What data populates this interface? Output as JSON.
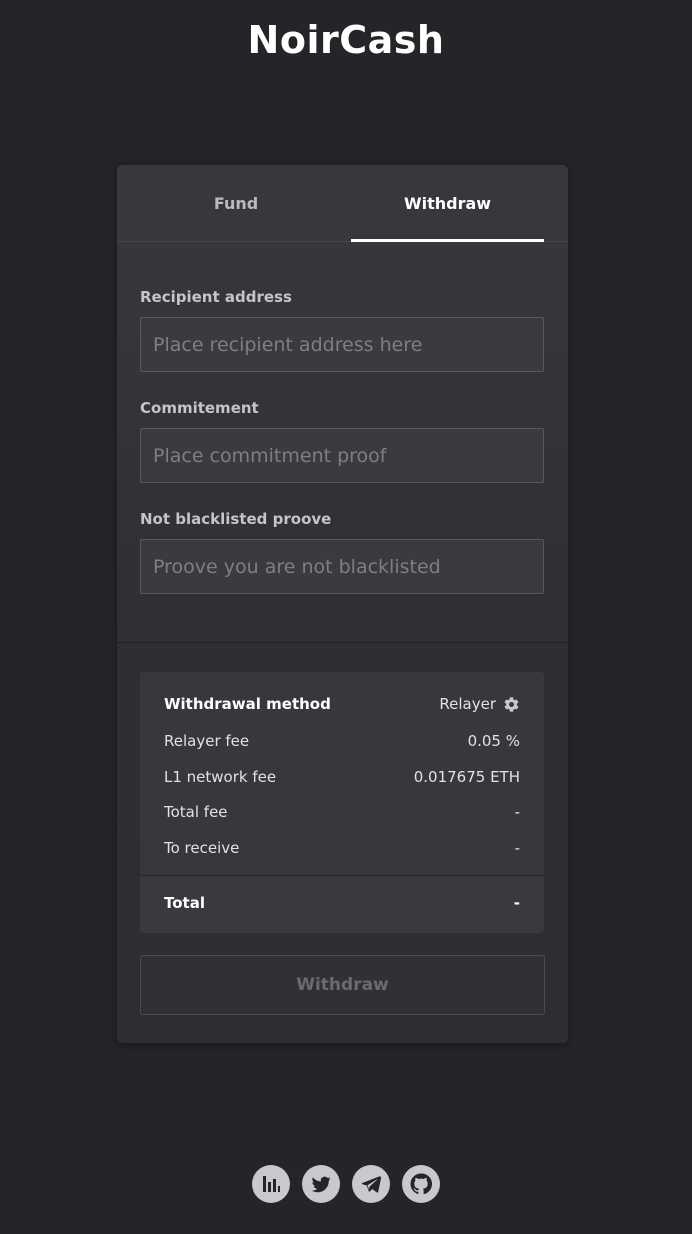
{
  "brand": {
    "title": "NoirCash"
  },
  "tabs": [
    {
      "label": "Fund",
      "active": false
    },
    {
      "label": "Withdraw",
      "active": true
    }
  ],
  "form": {
    "recipient": {
      "label": "Recipient address",
      "placeholder": "Place recipient address here",
      "value": ""
    },
    "commitment": {
      "label": "Commitement",
      "placeholder": "Place commitment proof",
      "value": ""
    },
    "blacklist": {
      "label": "Not blacklisted proove",
      "placeholder": "Proove you are not blacklisted",
      "value": ""
    }
  },
  "summary": {
    "method": {
      "label": "Withdrawal method",
      "value": "Relayer",
      "icon": "gear-icon"
    },
    "rows": [
      {
        "label": "Relayer fee",
        "value": "0.05 %"
      },
      {
        "label": "L1 network fee",
        "value": "0.017675 ETH"
      },
      {
        "label": "Total fee",
        "value": "-"
      },
      {
        "label": "To receive",
        "value": "-"
      }
    ],
    "total": {
      "label": "Total",
      "value": "-"
    }
  },
  "actions": {
    "withdraw_label": "Withdraw",
    "withdraw_enabled": false
  },
  "footer": {
    "icons": [
      "stats-icon",
      "twitter-icon",
      "telegram-icon",
      "github-icon"
    ]
  },
  "colors": {
    "background": "#242528",
    "card": "#333438",
    "accent": "#ffffff",
    "icon": "#c9c9cb"
  }
}
